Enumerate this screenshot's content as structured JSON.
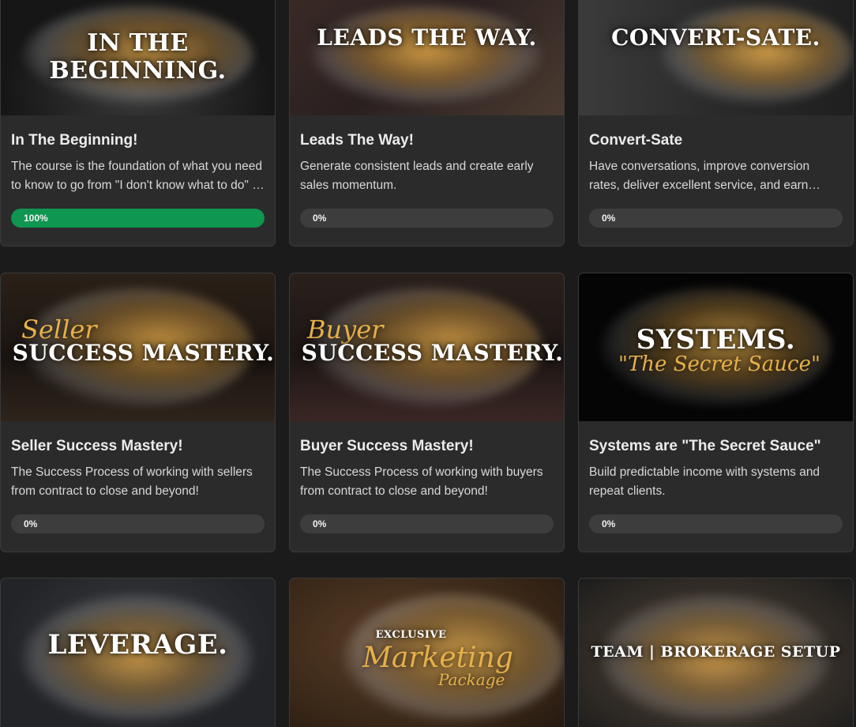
{
  "courses": [
    {
      "thumb_text": "IN THE BEGINNING.",
      "title": "In The Beginning!",
      "description": "The course is the foundation of what you need to know to go from \"I don't know what to do\" to confidently running your business.",
      "progress_label": "100%",
      "progress": 1.0
    },
    {
      "thumb_text": "LEADS THE WAY.",
      "title": "Leads The Way!",
      "description": "Generate consistent leads and create early sales momentum.",
      "progress_label": "0%",
      "progress": 0
    },
    {
      "thumb_text": "CONVERT-SATE.",
      "title": "Convert-Sate",
      "description": "Have conversations, improve conversion rates, deliver excellent service, and earn referrals.",
      "progress_label": "0%",
      "progress": 0
    },
    {
      "thumb_script": "Seller",
      "thumb_text": "SUCCESS MASTERY.",
      "title": "Seller Success Mastery!",
      "description": "The Success Process of working with sellers from contract to close and beyond!",
      "progress_label": "0%",
      "progress": 0
    },
    {
      "thumb_script": "Buyer",
      "thumb_text": "SUCCESS MASTERY.",
      "title": "Buyer Success Mastery!",
      "description": "The Success Process of working with buyers from contract to close and beyond!",
      "progress_label": "0%",
      "progress": 0
    },
    {
      "thumb_text": "SYSTEMS.",
      "thumb_script": "\"The Secret Sauce\"",
      "title": "Systems are \"The Secret Sauce\"",
      "description": "Build predictable income with systems and repeat clients.",
      "progress_label": "0%",
      "progress": 0
    },
    {
      "thumb_text": "LEVERAGE."
    },
    {
      "thumb_text": "EXCLUSIVE",
      "thumb_script": "Marketing",
      "thumb_script2": "Package"
    },
    {
      "thumb_text": "TEAM | BROKERAGE SETUP"
    }
  ],
  "colors": {
    "progress_fill": "#0f9650",
    "progress_track": "#3d3d3d",
    "card_bg": "#2b2b2b",
    "page_bg": "#1b1b1b",
    "accent_gold": "#e6b04a"
  }
}
